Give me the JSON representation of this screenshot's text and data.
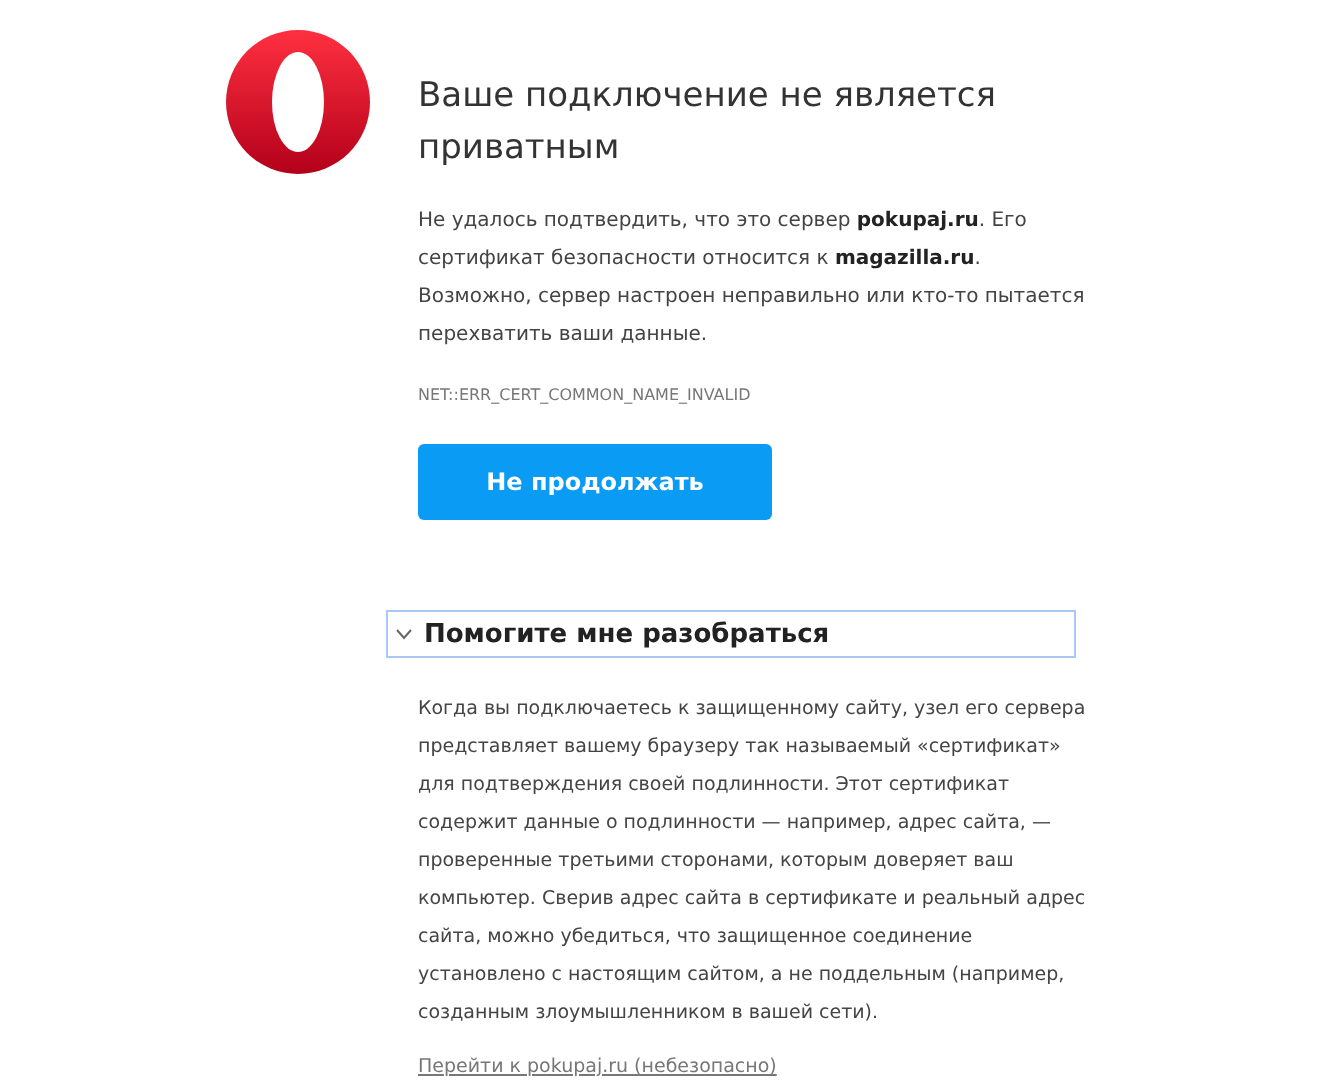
{
  "title": "Ваше подключение не является приватным",
  "message": "Не удалось подтвердить, что это сервер **pokupaj.ru**. Его сертификат безопасности относится к **magazilla.ru**. Возможно, сервер настроен неправильно или кто-то пытается перехватить ваши данные.",
  "error_code": "NET::ERR_CERT_COMMON_NAME_INVALID",
  "primary_button": "Не продолжать",
  "details": {
    "label": "Помогите мне разобраться",
    "expanded": true,
    "text": "Когда вы подключаетесь к защищенному сайту, узел его сервера представляет вашему браузеру так называемый «сертификат» для подтверждения своей подлинности. Этот сертификат содержит данные о подлинности — например, адрес сайта, — проверенные третьими сторонами, которым доверяет ваш компьютер. Сверив адрес сайта в сертификате и реальный адрес сайта, можно убедиться, что защищенное соединение установлено с настоящим сайтом, а не поддельным (например, созданным злоумышленником в вашей сети).",
    "proceed_link": "Перейти к pokupaj.ru (небезопасно)"
  }
}
